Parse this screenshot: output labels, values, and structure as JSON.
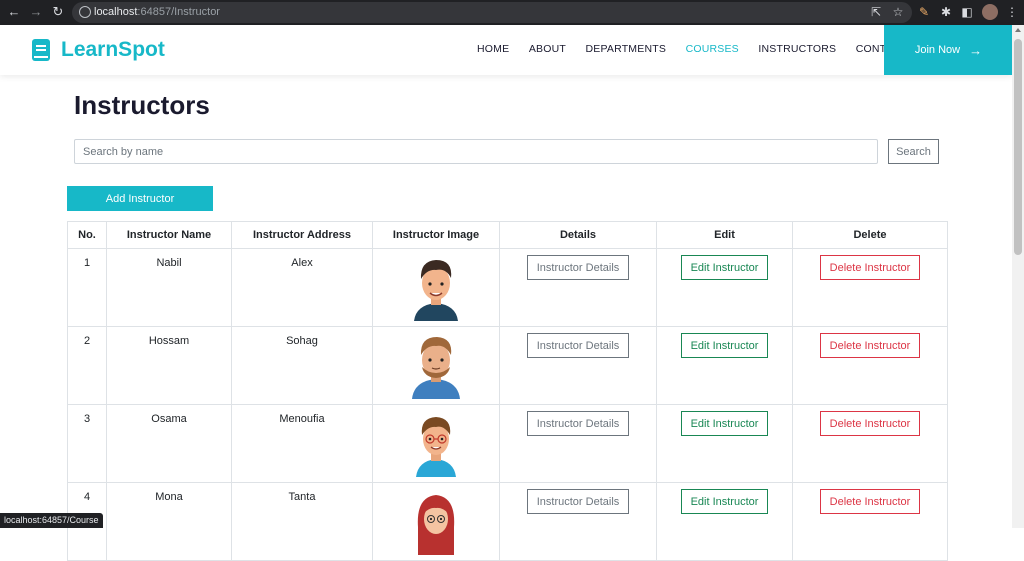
{
  "browser": {
    "url_host": "localhost",
    "url_path": ":64857/Instructor",
    "status_url": "localhost:64857/Course"
  },
  "site": {
    "brand": "LearnSpot",
    "brand_color": "#17b8c8",
    "nav": [
      "HOME",
      "ABOUT",
      "DEPARTMENTS",
      "COURSES",
      "INSTRUCTORS",
      "CONTACT"
    ],
    "active_nav": "COURSES",
    "join_label": "Join Now"
  },
  "page": {
    "title": "Instructors",
    "search_placeholder": "Search by name",
    "search_label": "Search",
    "add_label": "Add Instructor"
  },
  "table": {
    "headers": [
      "No.",
      "Instructor Name",
      "Instructor Address",
      "Instructor Image",
      "Details",
      "Edit",
      "Delete"
    ],
    "rows": [
      {
        "no": "1",
        "name": "Nabil",
        "address": "Alex",
        "avatar": "male-avatar-dark-hair",
        "details": "Instructor Details",
        "edit": "Edit Instructor",
        "delete": "Delete Instructor"
      },
      {
        "no": "2",
        "name": "Hossam",
        "address": "Sohag",
        "avatar": "male-avatar-beard",
        "details": "Instructor Details",
        "edit": "Edit Instructor",
        "delete": "Delete Instructor"
      },
      {
        "no": "3",
        "name": "Osama",
        "address": "Menoufia",
        "avatar": "male-avatar-glasses",
        "details": "Instructor Details",
        "edit": "Edit Instructor",
        "delete": "Delete Instructor"
      },
      {
        "no": "4",
        "name": "Mona",
        "address": "Tanta",
        "avatar": "female-avatar-glasses",
        "details": "Instructor Details",
        "edit": "Edit Instructor",
        "delete": "Delete Instructor"
      }
    ]
  },
  "colors": {
    "accent": "#17b8c8",
    "details_btn": "#6c757d",
    "edit_btn": "#198754",
    "delete_btn": "#dc3545"
  }
}
